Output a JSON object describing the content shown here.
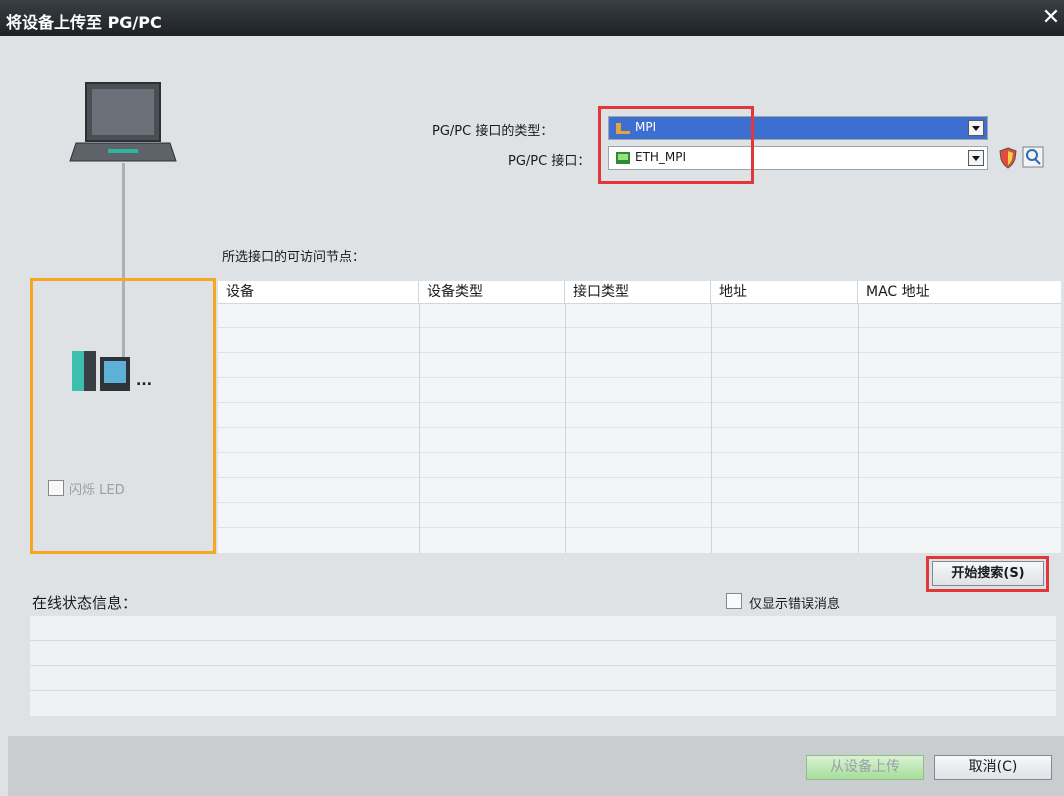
{
  "window": {
    "title": "将设备上传至 PG/PC",
    "close_symbol": "✕"
  },
  "interface": {
    "type_label": "PG/PC 接口的类型：",
    "type_value": "MPI",
    "port_label": "PG/PC 接口：",
    "port_value": "ETH_MPI"
  },
  "nodes": {
    "title": "所选接口的可访问节点：",
    "columns": [
      "设备",
      "设备类型",
      "接口类型",
      "地址",
      "MAC 地址"
    ]
  },
  "device_panel": {
    "ellipsis": "...",
    "flash_led_label": "闪烁 LED"
  },
  "search_button": {
    "label": "开始搜索(S)"
  },
  "status": {
    "title": "在线状态信息：",
    "errors_only_label": "仅显示错误消息"
  },
  "footer": {
    "upload_label": "从设备上传",
    "cancel_label": "取消(C)"
  },
  "colors": {
    "highlight_red": "#e03838",
    "highlight_orange": "#f5a623",
    "selection_blue": "#3d6fd1"
  }
}
